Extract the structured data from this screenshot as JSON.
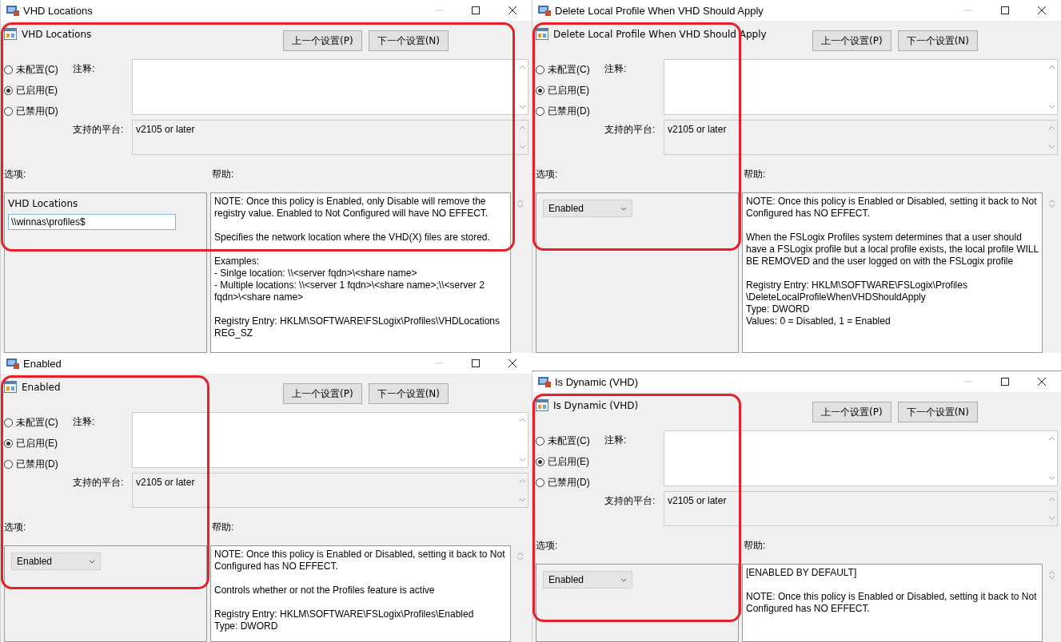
{
  "windows": [
    {
      "title": "VHD Locations",
      "heading": "VHD Locations",
      "highlighted": true,
      "buttons": [
        "上一个设置(P)",
        "下一个设置(N)"
      ],
      "radios": [
        {
          "label": "未配置(C)",
          "selected": false
        },
        {
          "label": "已启用(E)",
          "selected": true
        },
        {
          "label": "已禁用(D)",
          "selected": false
        }
      ],
      "comment_label": "注释:",
      "platform_label": "支持的平台:",
      "platform": "v2105 or later",
      "options_label": "选项:",
      "help_label": "帮助:",
      "option": {
        "kind": "text",
        "label": "VHD Locations",
        "value": "\\\\winnas\\profiles$"
      },
      "help": [
        [
          "NOTE:  Once this policy is Enabled, only Disable will remove the registry value. Enabled to Not Configured will have NO EFFECT."
        ],
        [
          "Specifies the network location where the VHD(X) files are stored."
        ],
        [
          "Examples:",
          "- Sinlge location:  \\\\<server fqdn>\\<share name>",
          "- Multiple locations: \\\\<server 1 fqdn>\\<share name>;\\\\<server 2 fqdn>\\<share name>"
        ],
        [
          "Registry Entry:  HKLM\\SOFTWARE\\FSLogix\\Profiles\\VHDLocations",
          "REG_SZ"
        ]
      ]
    },
    {
      "title": "Delete Local Profile When VHD Should Apply",
      "heading": "Delete Local Profile When VHD Should Apply",
      "highlighted": true,
      "buttons": [
        "上一个设置(P)",
        "下一个设置(N)"
      ],
      "radios": [
        {
          "label": "未配置(C)",
          "selected": false
        },
        {
          "label": "已启用(E)",
          "selected": true
        },
        {
          "label": "已禁用(D)",
          "selected": false
        }
      ],
      "comment_label": "注释:",
      "platform_label": "支持的平台:",
      "platform": "v2105 or later",
      "options_label": "选项:",
      "help_label": "帮助:",
      "option": {
        "kind": "dropdown",
        "value": "Enabled"
      },
      "help": [
        [
          "NOTE:  Once this policy is Enabled or Disabled, setting it back to Not Configured has NO EFFECT."
        ],
        [
          "When the FSLogix Profiles system determines that a user should have a FSLogix profile but a local profile exists, the local profile WILL BE REMOVED and the user logged on with the FSLogix profile"
        ],
        [
          "Registry Entry:  HKLM\\SOFTWARE\\FSLogix\\Profiles",
          "\\DeleteLocalProfileWhenVHDShouldApply",
          "Type:  DWORD",
          "Values:  0 = Disabled, 1 = Enabled"
        ]
      ]
    },
    {
      "title": "Enabled",
      "heading": "Enabled",
      "highlighted": true,
      "buttons": [
        "上一个设置(P)",
        "下一个设置(N)"
      ],
      "radios": [
        {
          "label": "未配置(C)",
          "selected": false
        },
        {
          "label": "已启用(E)",
          "selected": true
        },
        {
          "label": "已禁用(D)",
          "selected": false
        }
      ],
      "comment_label": "注释:",
      "platform_label": "支持的平台:",
      "platform": "v2105 or later",
      "options_label": "选项:",
      "help_label": "帮助:",
      "option": {
        "kind": "dropdown",
        "value": "Enabled"
      },
      "help": [
        [
          "NOTE:  Once this policy is Enabled or Disabled, setting it back to Not Configured has NO EFFECT."
        ],
        [
          "Controls whether or not the Profiles feature is active"
        ],
        [
          "Registry Entry:  HKLM\\SOFTWARE\\FSLogix\\Profiles\\Enabled",
          "Type:  DWORD"
        ]
      ]
    },
    {
      "title": "Is Dynamic (VHD)",
      "heading": "Is Dynamic (VHD)",
      "highlighted": true,
      "buttons": [
        "上一个设置(P)",
        "下一个设置(N)"
      ],
      "radios": [
        {
          "label": "未配置(C)",
          "selected": false
        },
        {
          "label": "已启用(E)",
          "selected": true
        },
        {
          "label": "已禁用(D)",
          "selected": false
        }
      ],
      "comment_label": "注释:",
      "platform_label": "支持的平台:",
      "platform": "v2105 or later",
      "options_label": "选项:",
      "help_label": "帮助:",
      "option": {
        "kind": "dropdown",
        "value": "Enabled"
      },
      "help": [
        [
          "[ENABLED BY DEFAULT]"
        ],
        [
          "NOTE:  Once this policy is Enabled or Disabled, setting it back to Not Configured has NO EFFECT."
        ]
      ]
    }
  ]
}
